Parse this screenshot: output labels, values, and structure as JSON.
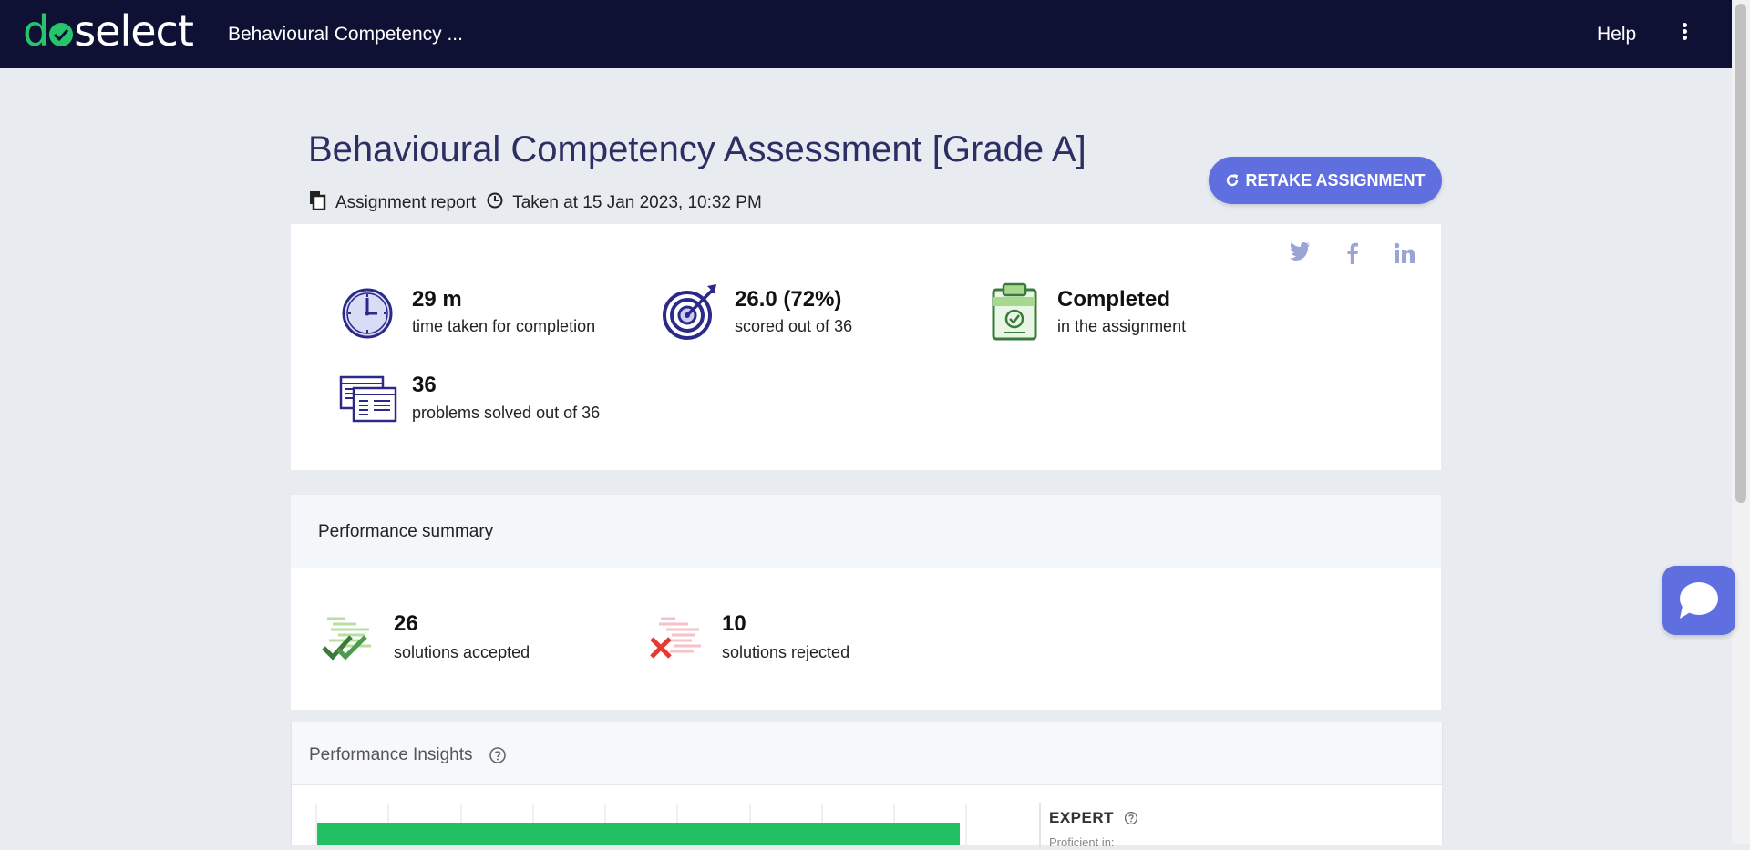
{
  "header": {
    "logo_left": "d",
    "logo_right": "select",
    "app_title": "Behavioural Competency ...",
    "help_label": "Help"
  },
  "assignment": {
    "title": "Behavioural Competency Assessment [Grade A]",
    "report_label": "Assignment report",
    "taken_at": "Taken at 15 Jan 2023, 10:32 PM",
    "retake_label": "RETAKE ASSIGNMENT"
  },
  "stats": [
    {
      "value": "29 m",
      "label": "time taken for completion",
      "icon": "clock-icon"
    },
    {
      "value": "26.0 (72%)",
      "label": "scored out of 36",
      "icon": "target-icon"
    },
    {
      "value": "Completed",
      "label": "in the assignment",
      "icon": "clipboard-check-icon"
    },
    {
      "value": "36",
      "label": "problems solved out of 36",
      "icon": "problems-icon"
    }
  ],
  "social": [
    "twitter-icon",
    "facebook-icon",
    "linkedin-icon"
  ],
  "performance_summary": {
    "title": "Performance summary",
    "accepted_value": "26",
    "accepted_label": "solutions accepted",
    "rejected_value": "10",
    "rejected_label": "solutions rejected"
  },
  "insights": {
    "title": "Performance Insights",
    "level": "EXPERT",
    "level_sub": "Proficient in:"
  },
  "colors": {
    "navbar": "#0e1133",
    "accent": "#5f6fe0",
    "title": "#2c2f63",
    "success": "#27c46b",
    "danger": "#e53935"
  }
}
